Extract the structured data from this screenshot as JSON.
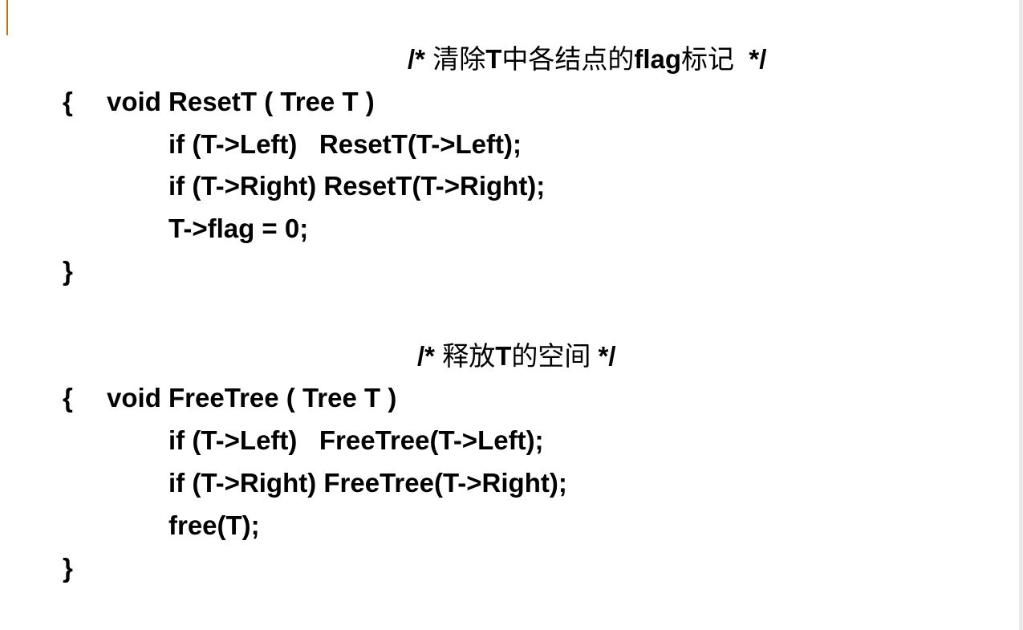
{
  "colors": {
    "accent": "#c0720f",
    "text": "#000000",
    "background": "#ffffff"
  },
  "code": {
    "reset": {
      "signature": "void ResetT ( Tree T )",
      "comment": {
        "open": "/* ",
        "cjk_a": "清除",
        "mid_a": "T",
        "cjk_b": "中各结点的",
        "mid_b": "flag",
        "cjk_c": "标记",
        "close": "  */"
      },
      "open_brace": "{",
      "body": [
        "if (T->Left)   ResetT(T->Left);",
        "if (T->Right) ResetT(T->Right);",
        "T->flag = 0;"
      ],
      "close_brace": "}"
    },
    "free": {
      "signature": "void FreeTree ( Tree T )",
      "comment": {
        "open": "/* ",
        "cjk_a": "释放",
        "mid_a": "T",
        "cjk_b": "的空间",
        "close": " */"
      },
      "open_brace": "{",
      "body": [
        "if (T->Left)   FreeTree(T->Left);",
        "if (T->Right) FreeTree(T->Right);",
        "free(T);"
      ],
      "close_brace": "}"
    }
  }
}
